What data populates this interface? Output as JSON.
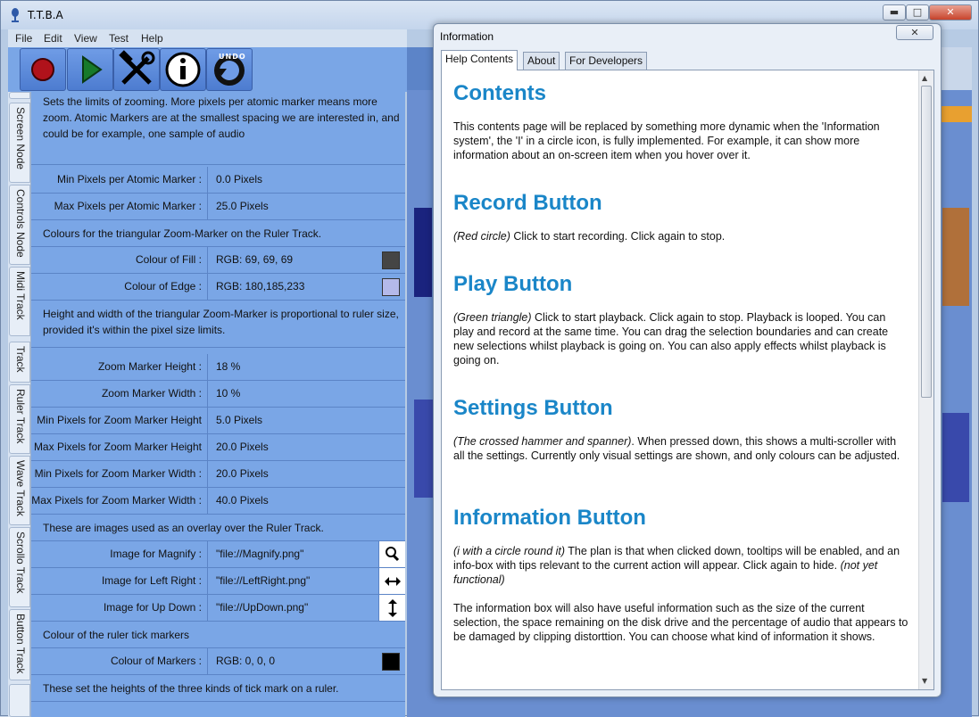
{
  "main_window": {
    "title": "T.T.B.A",
    "min_icon": "minimize-icon",
    "max_icon": "maximize-icon",
    "close_icon": "close-icon"
  },
  "menu": {
    "items": [
      "File",
      "Edit",
      "View",
      "Test",
      "Help"
    ]
  },
  "toolbar": {
    "buttons": [
      {
        "icon": "record-icon"
      },
      {
        "icon": "play-icon"
      },
      {
        "icon": "settings-icon"
      },
      {
        "icon": "info-icon"
      },
      {
        "icon": "undo-icon",
        "label": "UNDO"
      }
    ]
  },
  "vertical_tabs": [
    "Screen Node",
    "Controls Node",
    "Midi Track",
    "Track",
    "Ruler Track",
    "Wave Track",
    "Scrollo Track",
    "Button Track"
  ],
  "settings": {
    "desc1": "Sets the limits of zooming.  More pixels per atomic marker means more zoom. Atomic Markers are at the smallest spacing we are interested in, and could be for example, one sample of audio",
    "rows1": [
      {
        "label": "Min Pixels per Atomic Marker :",
        "value": "0.0  Pixels"
      },
      {
        "label": "Max Pixels per Atomic Marker :",
        "value": "25.0  Pixels"
      }
    ],
    "desc2": "Colours for the triangular Zoom-Marker on the Ruler Track.",
    "rows2": [
      {
        "label": "Colour of Fill :",
        "value": "RGB:  69, 69, 69",
        "color": "#454545"
      },
      {
        "label": "Colour of Edge :",
        "value": "RGB: 180,185,233",
        "color": "#b4b9e9"
      }
    ],
    "desc3": "Height and width of the triangular Zoom-Marker is proportional to ruler size, provided it's within the pixel size limits.",
    "rows3": [
      {
        "label": "Zoom Marker Height :",
        "value": "18 %"
      },
      {
        "label": "Zoom Marker Width :",
        "value": "10 %"
      },
      {
        "label": "Min Pixels for Zoom Marker Height",
        "value": "5.0  Pixels"
      },
      {
        "label": "Max Pixels for Zoom Marker Height",
        "value": "20.0  Pixels"
      },
      {
        "label": "Min Pixels for Zoom Marker Width :",
        "value": "20.0  Pixels"
      },
      {
        "label": "Max Pixels for Zoom Marker Width :",
        "value": "40.0  Pixels"
      }
    ],
    "desc4": "These are images used as an overlay over the Ruler Track.",
    "rows4": [
      {
        "label": "Image for Magnify :",
        "value": "\"file://Magnify.png\"",
        "icon": "magnify-icon"
      },
      {
        "label": "Image for Left Right :",
        "value": "\"file://LeftRight.png\"",
        "icon": "left-right-arrow-icon"
      },
      {
        "label": "Image for Up Down :",
        "value": "\"file://UpDown.png\"",
        "icon": "up-down-arrow-icon"
      }
    ],
    "desc5": "Colour of the ruler tick markers",
    "rows5": [
      {
        "label": "Colour of Markers :",
        "value": "RGB:  0,  0,  0",
        "color": "#000000"
      }
    ],
    "desc6": "These set the heights of the three kinds of tick mark on a ruler."
  },
  "info_window": {
    "title": "Information",
    "tabs": [
      "Help Contents",
      "About",
      "For Developers"
    ],
    "active_tab": "Help Contents",
    "sections": [
      {
        "heading": "Contents",
        "body": "This contents page will be replaced by something more dynamic when the 'Information system', the 'I' in a circle icon, is fully implemented. For example, it can show more information about an on-screen item when you hover over it."
      },
      {
        "heading": "Record Button",
        "lead": "(Red circle)",
        "body": " Click to start recording. Click again to stop."
      },
      {
        "heading": "Play Button",
        "lead": "(Green triangle)",
        "body": " Click to start playback. Click again to stop. Playback is looped. You can play and record at the same time. You can drag the selection boundaries and can create new selections whilst playback is going on. You can also apply effects whilst playback is going on."
      },
      {
        "heading": "Settings Button",
        "lead": "(The crossed hammer and spanner)",
        "body": ". When pressed down, this shows a multi-scroller with all the settings. Currently only visual settings are shown, and only colours can be adjusted."
      },
      {
        "heading": "Information Button",
        "lead": "(i with a circle round it)",
        "body": " The plan is that when clicked down, tooltips will be enabled, and an info-box with tips relevant to the current action will appear. Click again to hide. ",
        "trail": "(not yet functional)"
      }
    ],
    "extra_para": "The information box will also have useful information such as the size of the current selection, the space remaining on the disk drive and the percentage of audio that appears to be damaged by clipping distorttion. You can choose what kind of information it shows."
  }
}
